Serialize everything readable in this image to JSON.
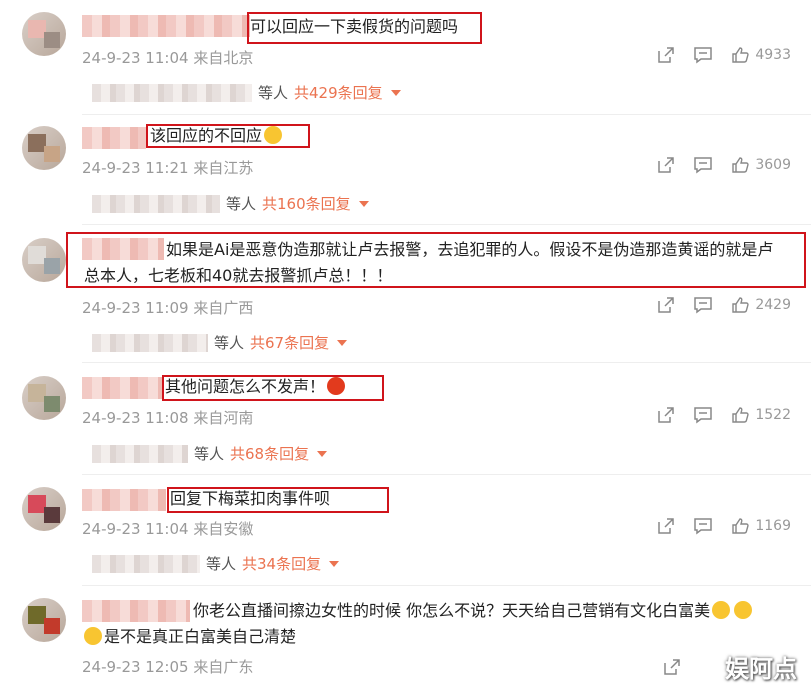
{
  "comments": [
    {
      "text": "可以回应一下卖假货的问题吗",
      "time": "24-9-23 11:04",
      "location": "来自北京",
      "likes": "4933",
      "replies_suffix": "等人",
      "replies_count": "共429条回复"
    },
    {
      "text": "该回应的不回应",
      "time": "24-9-23 11:21",
      "location": "来自江苏",
      "likes": "3609",
      "replies_suffix": "等人",
      "replies_count": "共160条回复"
    },
    {
      "text": "如果是Ai是恶意伪造那就让卢去报警，去追犯罪的人。假设不是伪造那造黄谣的就是卢总本人，七老板和40就去报警抓卢总！！！",
      "time": "24-9-23 11:09",
      "location": "来自广西",
      "likes": "2429",
      "replies_suffix": "等人",
      "replies_count": "共67条回复"
    },
    {
      "text": "其他问题怎么不发声！",
      "time": "24-9-23 11:08",
      "location": "来自河南",
      "likes": "1522",
      "replies_suffix": "等人",
      "replies_count": "共68条回复"
    },
    {
      "text": "回复下梅菜扣肉事件呗",
      "time": "24-9-23 11:04",
      "location": "来自安徽",
      "likes": "1169",
      "replies_suffix": "等人",
      "replies_count": "共34条回复"
    },
    {
      "text1": "你老公直播间擦边女性的时候 你怎么不说？天天给自己营销有文化白富美",
      "text2": "是不是真正白富美自己清楚",
      "time": "24-9-23 12:05",
      "location": "来自广东"
    }
  ],
  "watermark": "娱阿点",
  "colors": {
    "highlight": "#d0141b",
    "reply_count": "#eb7350"
  }
}
